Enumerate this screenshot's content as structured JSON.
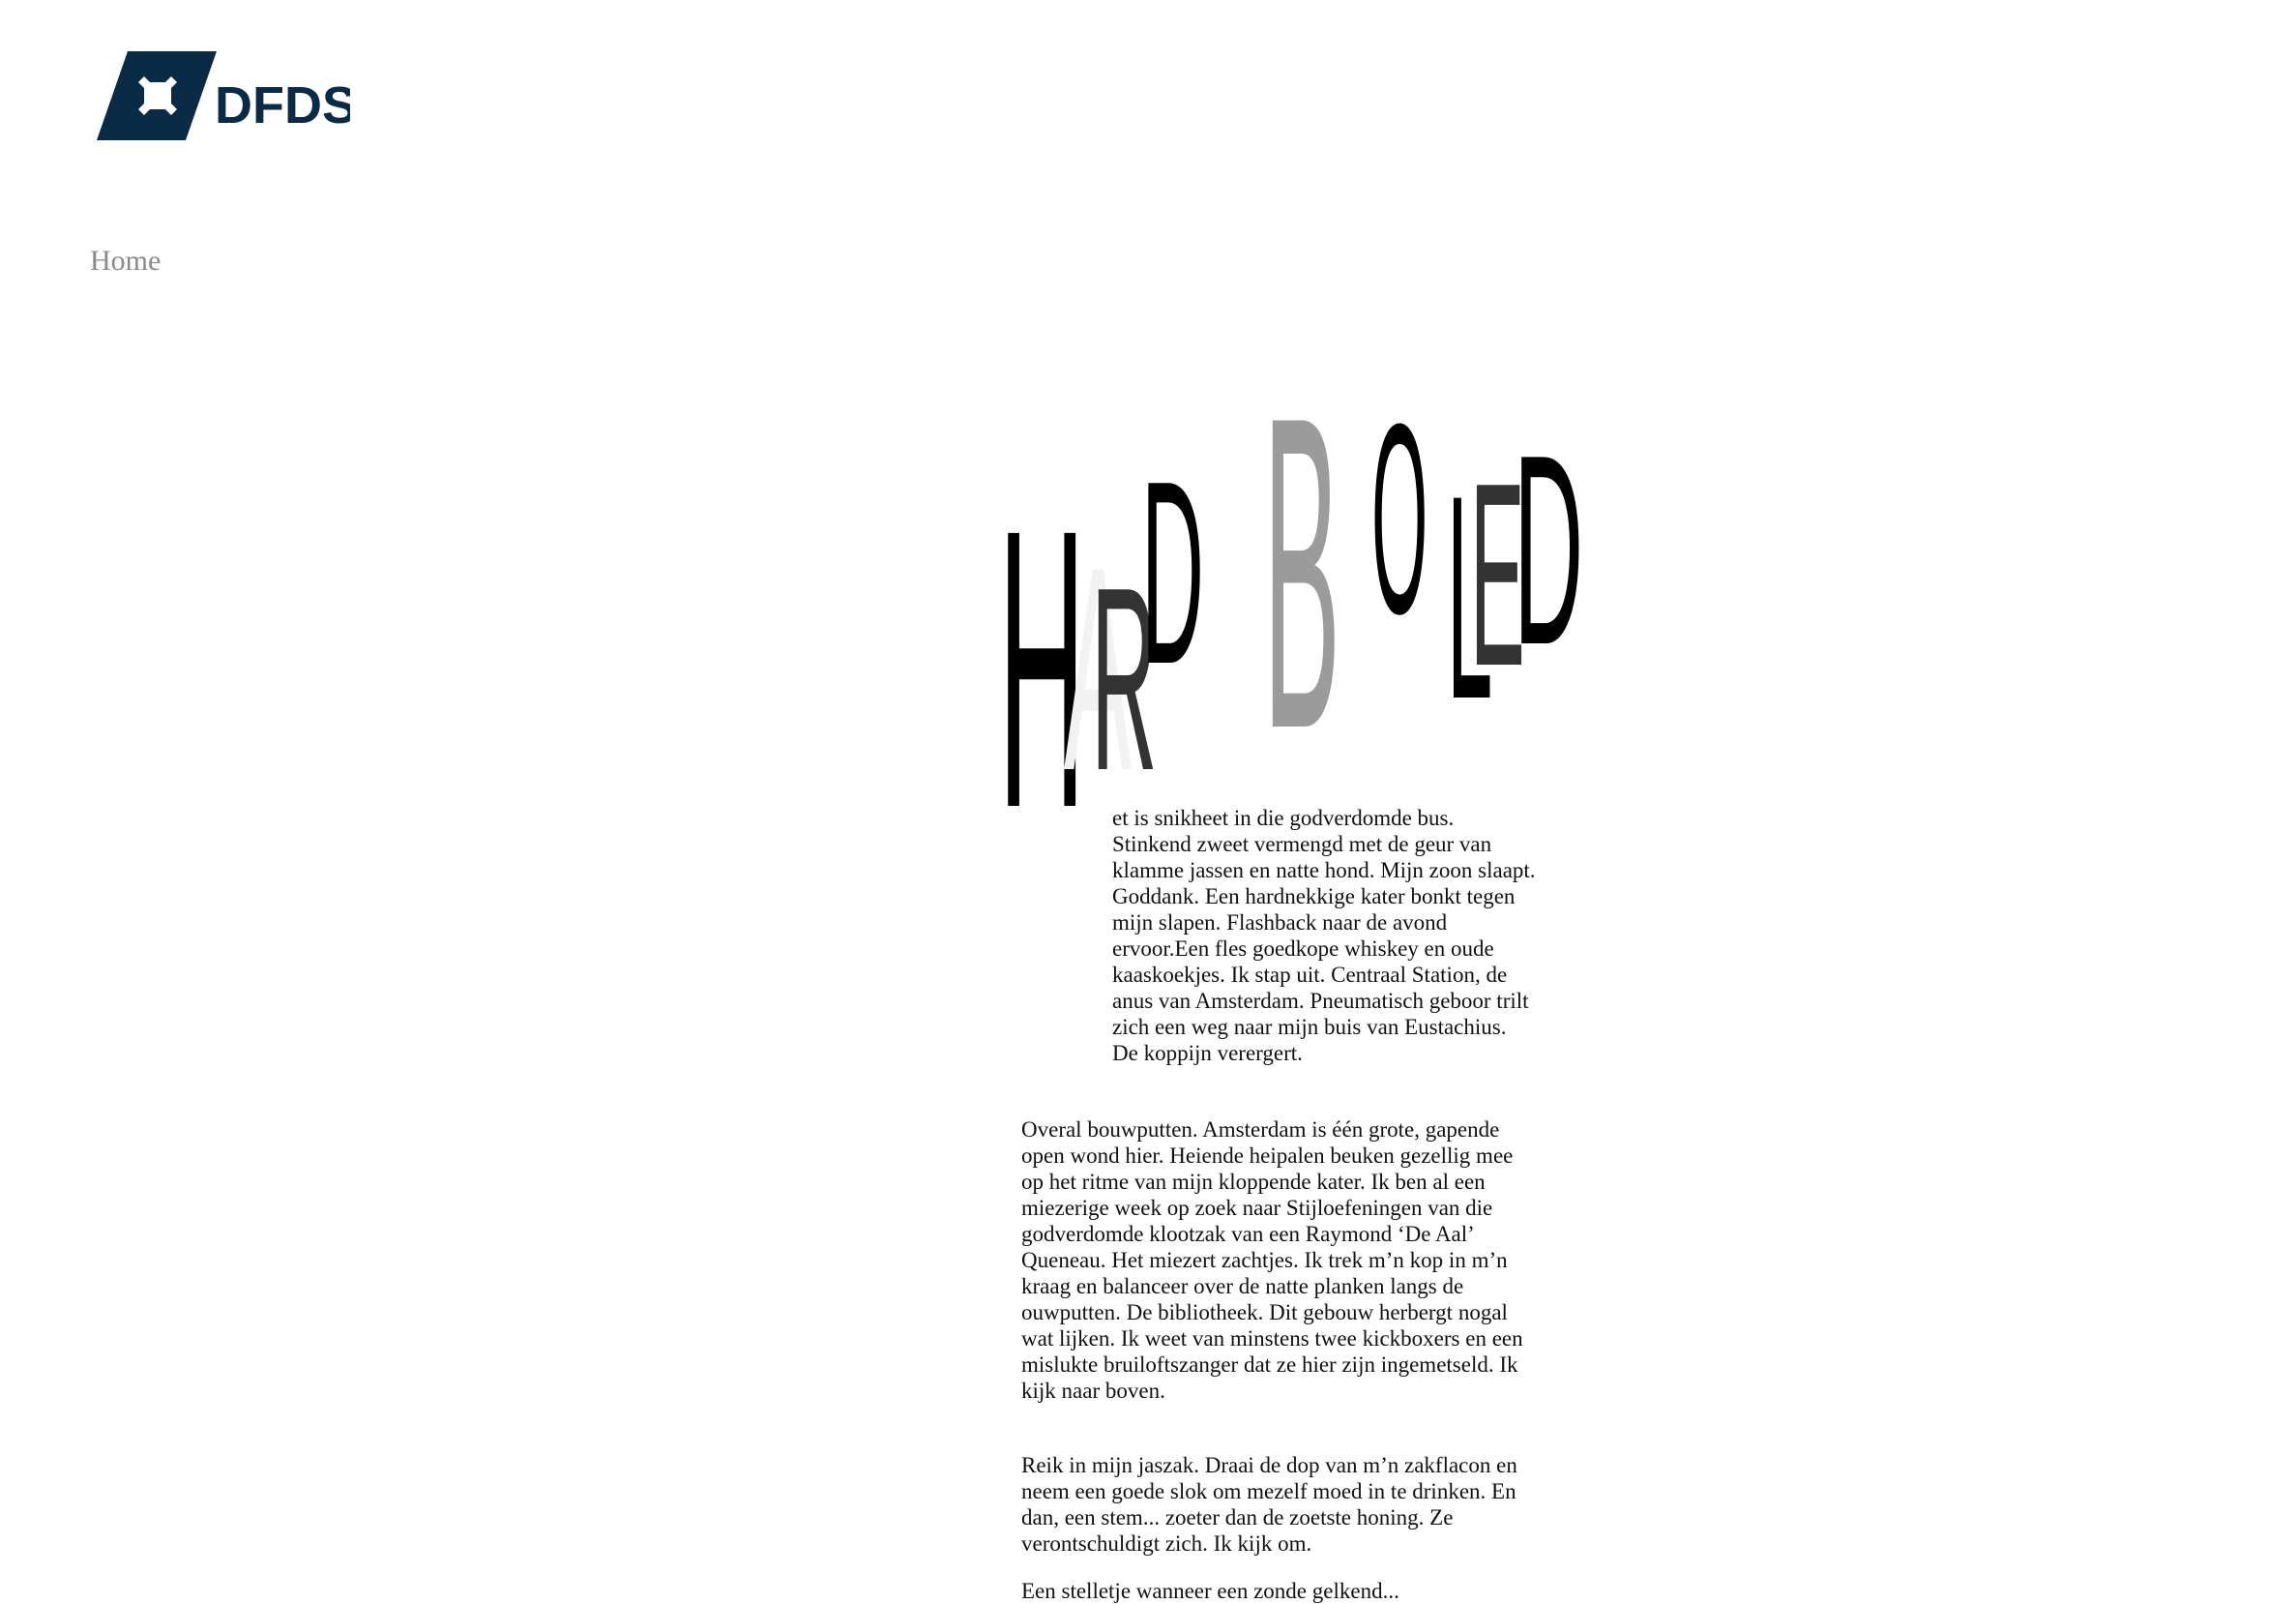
{
  "brand": {
    "logo_text": "DFDS",
    "color": "#0b2a46"
  },
  "nav": {
    "home_label": "Home"
  },
  "title": {
    "letters": [
      "H",
      "A",
      "R",
      "D",
      "B",
      "O",
      "L",
      "E",
      "D"
    ],
    "colors": [
      "#000000",
      "#f2f2f2",
      "#333333",
      "#000000",
      "#9b9b9b",
      "#000000",
      "#000000",
      "#333333",
      "#000000"
    ]
  },
  "story": {
    "p1": "et is snikheet in die godverdomde bus. Stinkend zweet vermengd met de geur van klamme jassen en natte hond. Mijn zoon slaapt. Goddank. Een hardnekkige kater bonkt tegen mijn slapen. Flashback naar de avond ervoor.Een fles goedkope whiskey en oude kaaskoekjes. Ik stap uit. Centraal Station, de anus van Amsterdam. Pneumatisch geboor trilt zich een weg naar mijn buis van Eustachius. De koppijn verergert.",
    "p2": "Overal bouwputten. Amsterdam is één grote, gapende open wond hier. Heiende heipalen beuken gezellig mee op het ritme van mijn kloppende kater. Ik ben al een miezerige week op zoek naar Stijloefeningen van die godverdomde klootzak van een Raymond ‘De Aal’ Queneau. Het miezert zachtjes. Ik trek m’n kop in m’n kraag en balanceer over de natte planken langs de ouwputten. De bibliotheek. Dit gebouw herbergt nogal wat lijken. Ik weet van minstens twee kickboxers en een mislukte bruiloftszanger dat ze hier zijn ingemetseld. Ik kijk naar boven.",
    "p3": "Reik in mijn jaszak. Draai de dop van m’n zakflacon en neem een goede slok om mezelf moed in te drinken. En dan, een stem... zoeter dan de zoetste honing. Ze verontschuldigt zich. Ik kijk om.",
    "p4": "Een stelletje wanneer een zonde gelkend..."
  }
}
